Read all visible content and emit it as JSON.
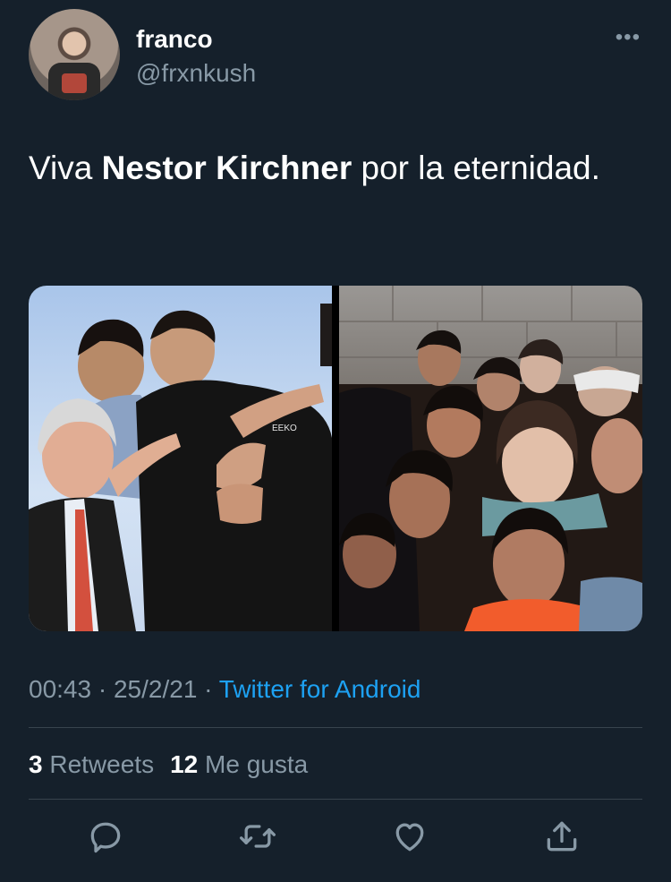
{
  "user": {
    "name": "franco",
    "handle": "@frxnkush"
  },
  "tweet": {
    "text_before": "Viva ",
    "text_bold": "Nestor Kirchner",
    "text_after": " por la eternidad."
  },
  "media": {
    "left_caption": "EEKO"
  },
  "meta": {
    "time": "00:43",
    "separator1": " · ",
    "date": "25/2/21",
    "separator2": " · ",
    "source": "Twitter for Android"
  },
  "stats": {
    "retweets_count": "3",
    "retweets_label": "Retweets",
    "likes_count": "12",
    "likes_label": "Me gusta"
  },
  "icons": {
    "more": "more-horizontal-icon",
    "reply": "reply-icon",
    "retweet": "retweet-icon",
    "like": "heart-icon",
    "share": "share-icon"
  },
  "colors": {
    "background": "#15202b",
    "secondary_text": "#8899a6",
    "link": "#1da1f2",
    "divider": "#38444d"
  }
}
